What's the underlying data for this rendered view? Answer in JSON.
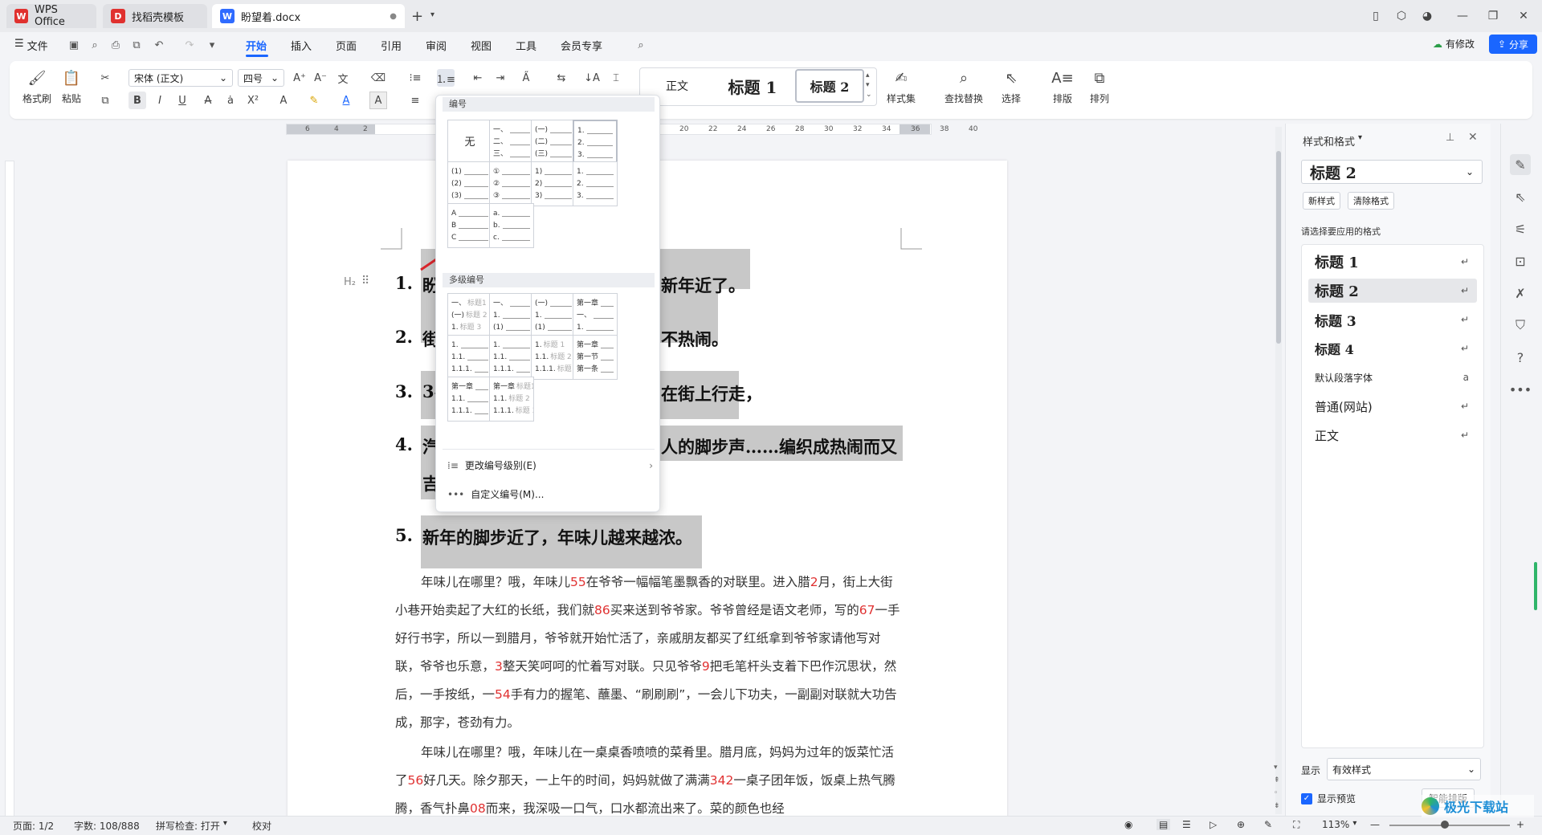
{
  "tabs": [
    {
      "label": "WPS Office",
      "logo": "W",
      "logo_color": "#e0312f"
    },
    {
      "label": "找稻壳模板",
      "logo": "D",
      "logo_color": "#e0312f"
    },
    {
      "label": "盼望着.docx",
      "logo": "W",
      "logo_color": "#2f6bff"
    }
  ],
  "menu": {
    "file": "文件",
    "items": [
      "开始",
      "插入",
      "页面",
      "引用",
      "审阅",
      "视图",
      "工具",
      "会员专享"
    ],
    "active": "开始",
    "modified": "有修改",
    "share": "分享"
  },
  "ribbon": {
    "format_painter": "格式刷",
    "paste": "粘贴",
    "font_name": "宋体 (正文)",
    "font_size": "四号",
    "styles": [
      "正文",
      "标题 1",
      "标题 2"
    ],
    "style_set": "样式集",
    "find_replace": "查找替换",
    "select": "选择",
    "layout": "排版",
    "arrange": "排列"
  },
  "ruler_ticks": [
    "6",
    "4",
    "2",
    "20",
    "22",
    "24",
    "26",
    "28",
    "30",
    "32",
    "34",
    "36",
    "38",
    "40"
  ],
  "document": {
    "headings": [
      {
        "num": "1.",
        "left": "盼",
        "right": "新年近了。"
      },
      {
        "num": "2.",
        "left": "街",
        "right": "不热闹。"
      },
      {
        "num": "3.",
        "left": "34",
        "right": "在街上行走，"
      },
      {
        "num": "4.",
        "left": "汽",
        "right": "人的脚步声……编织成热闹而又"
      },
      {
        "num": "",
        "left": "吉",
        "right": ""
      },
      {
        "num": "5.",
        "left": "新年的脚步近了，年味儿越来越浓。",
        "right": ""
      }
    ],
    "heading_marker": "H₂",
    "para1": [
      "年味儿在哪里？哦，年味儿",
      "55",
      "在爷爷一幅幅笔墨飘香的对联里。进入腊",
      "2",
      "月，街上大街小巷开始卖起了大红的长纸，我们就",
      "86",
      "买来送到爷爷家。爷爷曾经是语文老师，写的",
      "67",
      "一手好行书字，所以一到腊月，爷爷就开始忙活了，亲戚朋友都买了红纸拿到爷爷家请他写对联，爷爷也乐意，",
      "3",
      "整天笑呵呵的忙着写对联。只见爷爷",
      "9",
      "把毛笔杆头支着下巴作沉思状，然后，一手按纸，一",
      "54",
      "手有力的握笔、蘸墨、“刷刷刷”，一会儿下功夫，一副副对联就大功告成，那字，苍劲有力。"
    ],
    "para2": [
      "年味儿在哪里？哦，年味儿在一桌桌香喷喷的菜肴里。腊月底，妈妈为过年的饭菜忙活了",
      "56",
      "好几天。除夕那天，一上午的时间，妈妈就做了满满",
      "342",
      "一桌子团年饭，饭桌上热气腾腾，香气扑鼻",
      "08",
      "而来，我深吸一口气，口水都流出来了。菜的颜色也经"
    ]
  },
  "dropdown": {
    "section_numbering": "编号",
    "none_label": "无",
    "single_tiles": [
      [
        "一、",
        "二、",
        "三、"
      ],
      [
        "(一)",
        "(二)",
        "(三)"
      ],
      [
        "1.",
        "2.",
        "3."
      ],
      [
        "(1)",
        "(2)",
        "(3)"
      ],
      [
        "①",
        "②",
        "③"
      ],
      [
        "1)",
        "2)",
        "3)"
      ],
      [
        "1.",
        "2.",
        "3."
      ],
      [
        "A",
        "B",
        "C"
      ],
      [
        "a.",
        "b.",
        "c."
      ]
    ],
    "section_multilevel": "多级编号",
    "multi_tiles": [
      [
        [
          "一、",
          "标题1"
        ],
        [
          "(一)",
          "标题 2"
        ],
        [
          "1.",
          "标题 3"
        ]
      ],
      [
        [
          "一、",
          ""
        ],
        [
          "1.",
          ""
        ],
        [
          "(1)",
          ""
        ]
      ],
      [
        [
          "(一)",
          ""
        ],
        [
          "1.",
          ""
        ],
        [
          "(1)",
          ""
        ]
      ],
      [
        [
          "第一章",
          ""
        ],
        [
          "一、",
          ""
        ],
        [
          "1.",
          ""
        ]
      ],
      [
        [
          "1.",
          ""
        ],
        [
          "1.1.",
          ""
        ],
        [
          "1.1.1.",
          ""
        ]
      ],
      [
        [
          "1.",
          ""
        ],
        [
          "1.1.",
          ""
        ],
        [
          "1.1.1.",
          ""
        ]
      ],
      [
        [
          "1.",
          "标题 1"
        ],
        [
          "1.1.",
          "标题 2"
        ],
        [
          "1.1.1.",
          "标题 3"
        ]
      ],
      [
        [
          "第一章",
          ""
        ],
        [
          "第一节",
          ""
        ],
        [
          "第一条",
          ""
        ]
      ],
      [
        [
          "第一章",
          ""
        ],
        [
          "1.1.",
          ""
        ],
        [
          "1.1.1.",
          ""
        ]
      ],
      [
        [
          "第一章",
          "标题1"
        ],
        [
          "1.1.",
          "标题 2"
        ],
        [
          "1.1.1.",
          "标题 3"
        ]
      ]
    ],
    "change_level": "更改编号级别(E)",
    "custom": "自定义编号(M)..."
  },
  "style_panel": {
    "title": "样式和格式",
    "current": "标题 2",
    "new_style": "新样式",
    "clear_format": "清除格式",
    "prompt": "请选择要应用的格式",
    "styles": [
      "标题 1",
      "标题 2",
      "标题 3",
      "标题 4",
      "默认段落字体",
      "普通(网站)",
      "正文"
    ],
    "selected": "标题 2",
    "show_label": "显示",
    "show_value": "有效样式",
    "preview_label": "显示预览",
    "smart_layout": "智能排版"
  },
  "status": {
    "page": "页面: 1/2",
    "words": "字数: 108/888",
    "spell": "拼写检查: 打开",
    "proof": "校对",
    "zoom": "113%"
  },
  "watermark": "极光下载站",
  "colors": {
    "accent": "#1a66ff",
    "number_red": "#e03131",
    "highlight": "#c8c8c8",
    "arrow": "#d9262c"
  }
}
